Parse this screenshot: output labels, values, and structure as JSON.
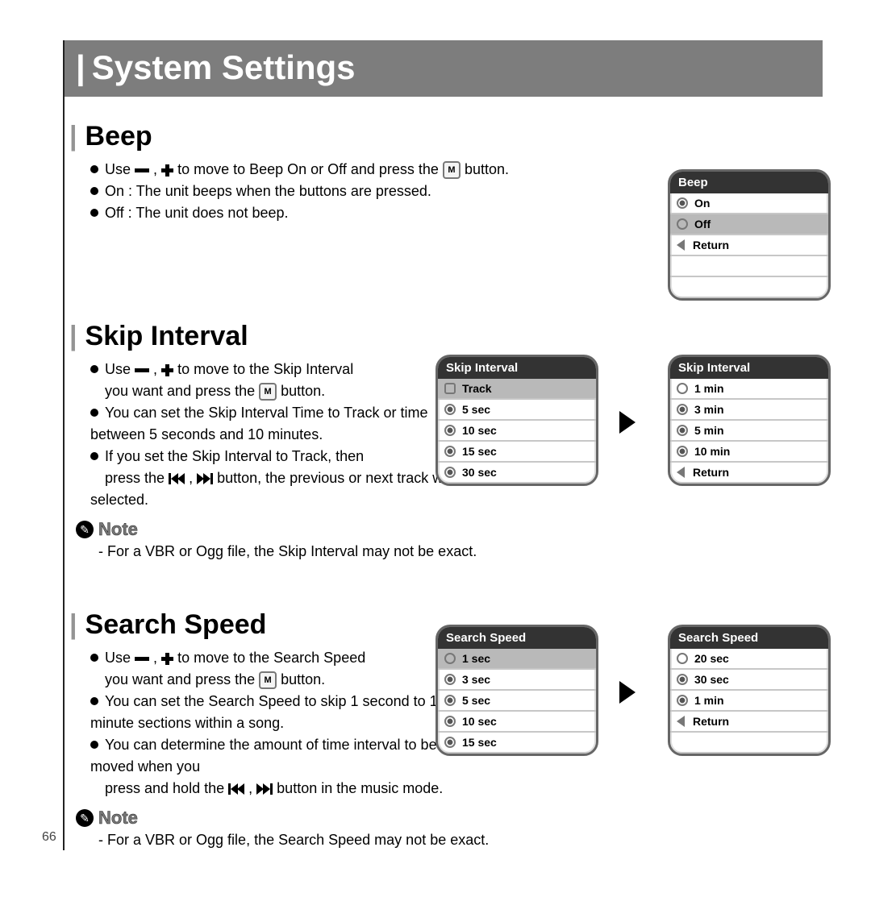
{
  "page_number": "66",
  "page_title": "System Settings",
  "beep": {
    "heading": "Beep",
    "line1a": "Use ",
    "line1b": " to move to Beep On or Off and press the ",
    "line1c": " button.",
    "line2": "On : The unit beeps when the buttons are pressed.",
    "line3": "Off : The unit does not beep.",
    "menu_title": "Beep",
    "opts": [
      "On",
      "Off",
      "Return"
    ]
  },
  "skip": {
    "heading": "Skip Interval",
    "line1a": "Use ",
    "line1b": " to move to the Skip Interval",
    "line1c": "you want and press the ",
    "line1d": " button.",
    "line2": "You can set the Skip Interval Time to Track or time between 5 seconds and 10 minutes.",
    "line3a": "If you set the Skip Interval to Track, then",
    "line3b": "press the ",
    "line3c": " button, the previous or next track will be selected.",
    "note": "For a VBR or Ogg file, the Skip Interval may not be exact.",
    "menu_title": "Skip Interval",
    "opts1": [
      "Track",
      "5 sec",
      "10 sec",
      "15 sec",
      "30 sec"
    ],
    "opts2": [
      "1 min",
      "3 min",
      "5 min",
      "10 min",
      "Return"
    ]
  },
  "search": {
    "heading": "Search Speed",
    "line1a": "Use ",
    "line1b": " to move to the Search Speed",
    "line1c": "you want and press the ",
    "line1d": " button.",
    "line2": "You can set the Search Speed to skip 1 second to 1 minute sections within a song.",
    "line3a": "You can determine the amount of time interval to be moved when you",
    "line3b": "press and hold the ",
    "line3c": " button in the music mode.",
    "note": "For a VBR or Ogg file, the Search Speed may not be exact.",
    "menu_title": "Search Speed",
    "opts1": [
      "1 sec",
      "3 sec",
      "5 sec",
      "10 sec",
      "15 sec"
    ],
    "opts2": [
      "20 sec",
      "30 sec",
      "1 min",
      "Return"
    ]
  },
  "note_word": "Note",
  "icons": {
    "m": "M",
    "comma": ",",
    "dash": "-"
  }
}
